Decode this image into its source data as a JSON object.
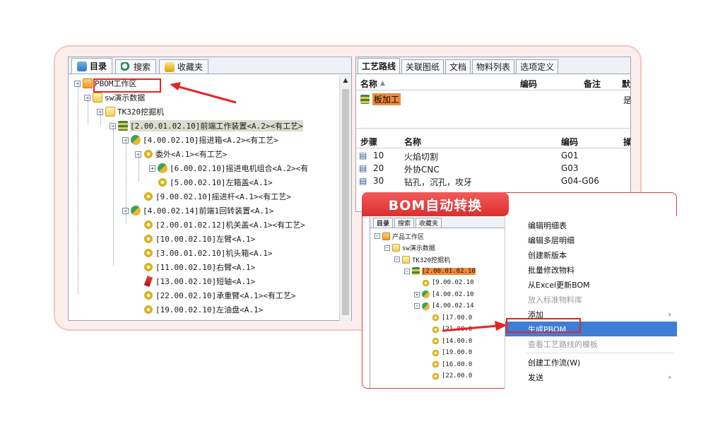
{
  "tree_tabs": [
    "目录",
    "搜索",
    "收藏夹"
  ],
  "tree_nodes": [
    {
      "label": "PBOM工作区",
      "icon": "root-icon",
      "toggle": "-"
    },
    {
      "label": "sw演示数据",
      "icon": "folder-icon",
      "toggle": "-"
    },
    {
      "label": "TK320挖掘机",
      "icon": "folder-icon",
      "toggle": "-"
    },
    {
      "label": "[2.00.01.02.10]前端工作装置<A.2><有工艺>",
      "icon": "stack-icon",
      "toggle": "-",
      "highlight": true
    },
    {
      "label": "[4.00.02.10]摇进箱<A.2><有工艺>",
      "icon": "assembly-icon",
      "toggle": "-"
    },
    {
      "label": "委外<A.1><有工艺>",
      "icon": "gear-icon",
      "toggle": "-"
    },
    {
      "label": "[6.00.02.10]摇进电机组合<A.2><有",
      "icon": "assembly-icon",
      "toggle": "+"
    },
    {
      "label": "[5.00.02.10]左箱盖<A.1>",
      "icon": "gear-icon",
      "toggle": ""
    },
    {
      "label": "[9.00.02.10]摇进杆<A.1><有工艺>",
      "icon": "gear-icon",
      "toggle": ""
    },
    {
      "label": "[4.00.02.14]前端1回转装置<A.1>",
      "icon": "assembly-icon",
      "toggle": "-"
    },
    {
      "label": "[2.00.01.02.12]机关盖<A.1><有工艺>",
      "icon": "gear-icon",
      "toggle": ""
    },
    {
      "label": "[10.00.02.10]左臂<A.1>",
      "icon": "gear-icon",
      "toggle": ""
    },
    {
      "label": "[3.00.01.02.10]机头箱<A.1>",
      "icon": "gear-icon",
      "toggle": ""
    },
    {
      "label": "[11.00.02.10]右臂<A.1>",
      "icon": "gear-icon",
      "toggle": ""
    },
    {
      "label": "[13.00.02.10]短轴<A.1>",
      "icon": "pin-icon",
      "toggle": ""
    },
    {
      "label": "[22.00.02.10]承重臂<A.1><有工艺>",
      "icon": "gear-icon",
      "toggle": ""
    },
    {
      "label": "[19.00.02.10]左油盘<A.1>",
      "icon": "gear-icon",
      "toggle": ""
    }
  ],
  "proc_tabs": [
    "工艺路线",
    "关联图纸",
    "文档",
    "物料列表",
    "选项定义"
  ],
  "top_table": {
    "headers": [
      "名称",
      "编码",
      "备注",
      "默"
    ],
    "row": {
      "name": "板加工",
      "code": "",
      "note": "",
      "flag": "是"
    }
  },
  "step_table": {
    "headers": [
      "步骤",
      "名称",
      "编码",
      "操"
    ],
    "rows": [
      {
        "step": "10",
        "name": "火焰切割",
        "code": "G01"
      },
      {
        "step": "20",
        "name": "外协CNC",
        "code": "G03"
      },
      {
        "step": "30",
        "name": "钻孔，沉孔，攻牙",
        "code": "G04-G06"
      }
    ]
  },
  "banner": "BOM自动转换",
  "inset_tabs": [
    "目录",
    "搜索",
    "收藏夹"
  ],
  "inset_nodes": [
    {
      "label": "产品工作区",
      "toggle": "-"
    },
    {
      "label": "sw演示数据",
      "toggle": "-"
    },
    {
      "label": "TK320挖掘机",
      "toggle": "-"
    },
    {
      "label": "[2.00.01.02.10",
      "toggle": "-"
    },
    {
      "label": "[9.00.02.10",
      "toggle": ""
    },
    {
      "label": "[4.00.02.10",
      "toggle": "+"
    },
    {
      "label": "[4.00.02.14",
      "toggle": "-"
    },
    {
      "label": "[17.00.0",
      "toggle": ""
    },
    {
      "label": "[21.00.0",
      "toggle": ""
    },
    {
      "label": "[14.00.0",
      "toggle": ""
    },
    {
      "label": "[19.00.0",
      "toggle": ""
    },
    {
      "label": "[16.00.0",
      "toggle": ""
    },
    {
      "label": "[22.00.0",
      "toggle": ""
    }
  ],
  "context_menu": [
    {
      "label": "编辑明细表"
    },
    {
      "label": "编辑多层明细"
    },
    {
      "label": "创建新版本"
    },
    {
      "label": "批量修改物料"
    },
    {
      "label": "从Excel更新BOM"
    },
    {
      "label": "放入标准物料库",
      "disabled": true
    },
    {
      "label": "添加",
      "submenu": true
    },
    {
      "label": "生成PBOM",
      "active": true
    },
    {
      "label": "查看工艺路线的模板",
      "disabled": true
    },
    {
      "label": "创建工作流(W)",
      "sep_before": true
    },
    {
      "label": "发送",
      "submenu": true
    }
  ],
  "colors": {
    "accent_red": "#e52525",
    "menu_highlight": "#3d7fd6"
  }
}
